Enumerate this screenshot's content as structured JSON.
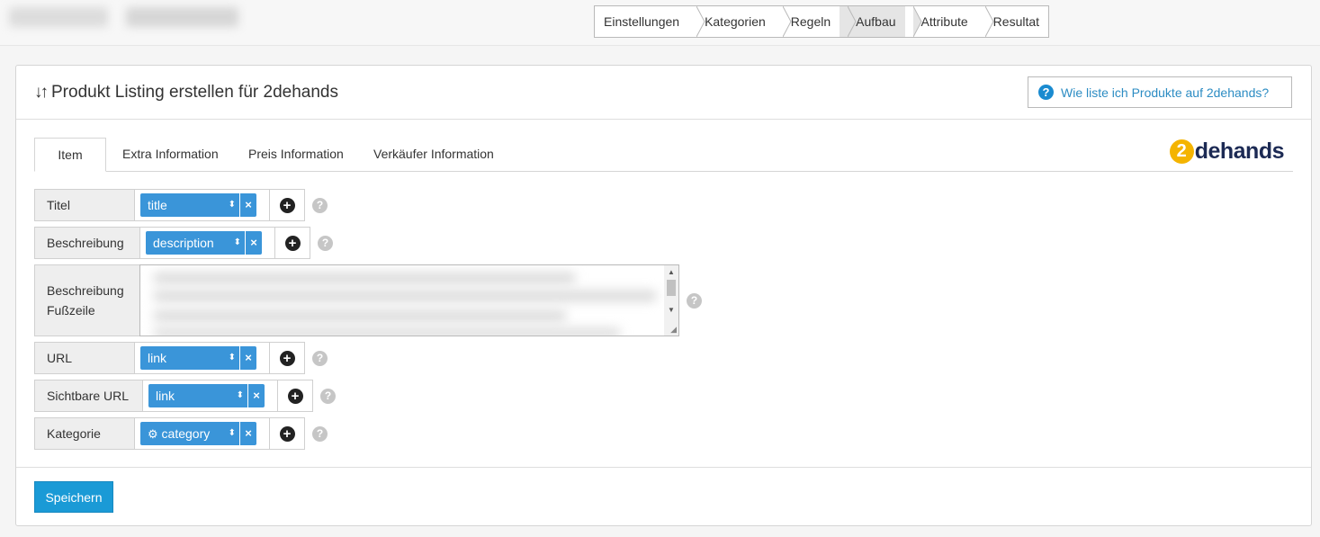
{
  "wizard": {
    "steps": [
      {
        "label": "Einstellungen",
        "active": false
      },
      {
        "label": "Kategorien",
        "active": false
      },
      {
        "label": "Regeln",
        "active": false
      },
      {
        "label": "Aufbau",
        "active": true
      },
      {
        "label": "Attribute",
        "active": false
      },
      {
        "label": "Resultat",
        "active": false
      }
    ]
  },
  "card": {
    "title": "Produkt Listing erstellen für 2dehands",
    "help_link": "Wie liste ich Produkte auf 2dehands?"
  },
  "tabs": [
    "Item",
    "Extra Information",
    "Preis Information",
    "Verkäufer Information"
  ],
  "brand": {
    "mark": "2",
    "name": "dehands",
    "colors": {
      "mark": "#f4b400",
      "word": "#1c2a54"
    }
  },
  "fields": {
    "titel": {
      "label": "Titel",
      "value": "title"
    },
    "beschreibung": {
      "label": "Beschreibung",
      "value": "description"
    },
    "beschreibung_fusszeile": {
      "label_line1": "Beschreibung",
      "label_line2": "Fußzeile"
    },
    "url": {
      "label": "URL",
      "value": "link"
    },
    "sichtbare_url": {
      "label": "Sichtbare URL",
      "value": "link"
    },
    "kategorie": {
      "label": "Kategorie",
      "value": "category",
      "icon": "gear-icon"
    }
  },
  "icons": {
    "remove": "×",
    "sort": "⬍",
    "add": "+",
    "help": "?",
    "sort_title": "↓↑"
  },
  "actions": {
    "save_label": "Speichern"
  },
  "colors": {
    "accent": "#3a95d9",
    "button": "#1a9ad6",
    "link": "#2c8cc3"
  }
}
